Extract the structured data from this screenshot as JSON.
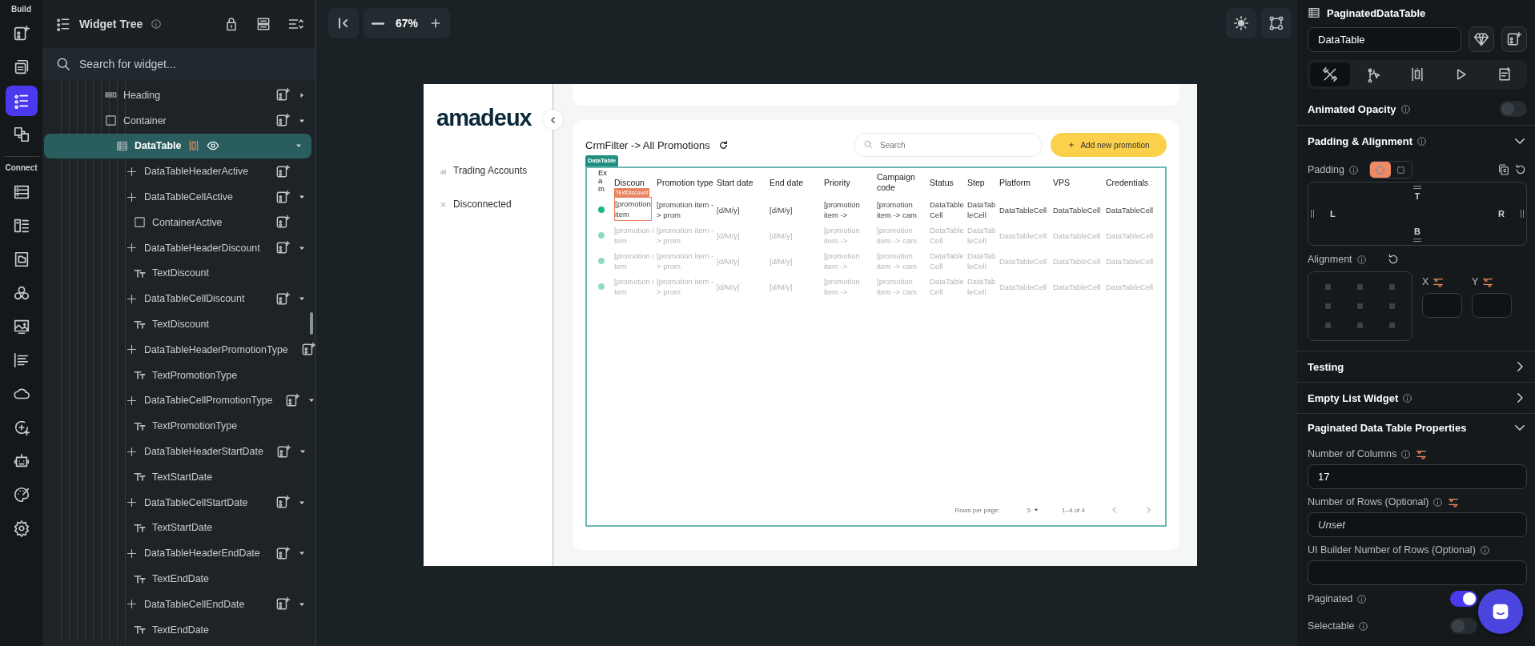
{
  "rail": {
    "build_label": "Build",
    "build": [
      {
        "selected": false
      },
      {
        "selected": false
      },
      {
        "selected": true
      },
      {
        "selected": false
      }
    ],
    "connect_label": "Connect",
    "connect": [
      {
        "selected": false
      },
      {
        "selected": false
      },
      {
        "selected": false
      },
      {
        "selected": false
      },
      {
        "selected": false
      },
      {
        "selected": false
      },
      {
        "selected": false
      },
      {
        "selected": false
      },
      {
        "selected": false
      },
      {
        "selected": false
      },
      {
        "selected": false
      }
    ]
  },
  "tree": {
    "title": "Widget Tree",
    "search": {
      "placeholder": "Search for widget..."
    },
    "items": [
      {
        "kind": "heading",
        "label": "Heading",
        "expanded": false,
        "selected": false
      },
      {
        "kind": "container",
        "label": "Container",
        "expanded": true,
        "selected": false,
        "children": [
          {
            "kind": "table",
            "label": "DataTable",
            "expanded": true,
            "selected": true,
            "children": [
              {
                "kind": "plus",
                "label": "DataTableHeaderActive",
                "selected": false
              },
              {
                "kind": "plus",
                "label": "DataTableCellActive",
                "expanded": true,
                "selected": false,
                "children": [
                  {
                    "kind": "container",
                    "label": "ContainerActive",
                    "selected": false
                  }
                ]
              },
              {
                "kind": "plus",
                "label": "DataTableHeaderDiscount",
                "expanded": true,
                "selected": false,
                "children": [
                  {
                    "kind": "text",
                    "label": "TextDiscount",
                    "selected": false
                  }
                ]
              },
              {
                "kind": "plus",
                "label": "DataTableCellDiscount",
                "expanded": true,
                "selected": false,
                "children": [
                  {
                    "kind": "text",
                    "label": "TextDiscount",
                    "selected": false
                  }
                ]
              },
              {
                "kind": "plus",
                "label": "DataTableHeaderPromotionType",
                "selected": false,
                "children": [
                  {
                    "kind": "text",
                    "label": "TextPromotionType",
                    "selected": false
                  }
                ]
              },
              {
                "kind": "plus",
                "label": "DataTableCellPromotionType",
                "expanded": true,
                "selected": false,
                "children": [
                  {
                    "kind": "text",
                    "label": "TextPromotionType",
                    "selected": false
                  }
                ]
              },
              {
                "kind": "plus",
                "label": "DataTableHeaderStartDate",
                "expanded": true,
                "selected": false,
                "children": [
                  {
                    "kind": "text",
                    "label": "TextStartDate",
                    "selected": false
                  }
                ]
              },
              {
                "kind": "plus",
                "label": "DataTableCellStartDate",
                "expanded": true,
                "selected": false,
                "children": [
                  {
                    "kind": "text",
                    "label": "TextStartDate",
                    "selected": false
                  }
                ]
              },
              {
                "kind": "plus",
                "label": "DataTableHeaderEndDate",
                "expanded": true,
                "selected": false,
                "children": [
                  {
                    "kind": "text",
                    "label": "TextEndDate",
                    "selected": false
                  }
                ]
              },
              {
                "kind": "plus",
                "label": "DataTableCellEndDate",
                "expanded": true,
                "selected": false,
                "children": [
                  {
                    "kind": "text",
                    "label": "TextEndDate",
                    "selected": false
                  }
                ]
              }
            ]
          }
        ]
      }
    ]
  },
  "canvas": {
    "zoom": "67%"
  },
  "app": {
    "logo": "amadeux",
    "nav": [
      {
        "kind": "chart",
        "label": "Trading Accounts"
      },
      {
        "kind": "cross",
        "label": "Disconnected"
      }
    ],
    "title": "CrmFilter -> All Promotions",
    "search": {
      "placeholder": "Search"
    },
    "add_button": "Add new promotion",
    "table": {
      "tag": "DataTable",
      "columns": [
        "Exam",
        "Discoun",
        "Promotion type",
        "Start date",
        "End date",
        "Priority",
        "Campaign code",
        "Status",
        "Step",
        "Platform",
        "VPS",
        "Credentials"
      ],
      "rows": [
        {
          "dimmed": false,
          "cells": [
            {
              "kind": "dot"
            },
            {
              "kind": "text",
              "text": "[promotion item",
              "selected": true,
              "tag": "TextDiscount"
            },
            {
              "kind": "text",
              "text": "[promotion item -> prom",
              "selected": false
            },
            {
              "kind": "text",
              "text": "[d/M/y]",
              "selected": false
            },
            {
              "kind": "text",
              "text": "[d/M/y]",
              "selected": false
            },
            {
              "kind": "text",
              "text": "[promotion item ->",
              "selected": false
            },
            {
              "kind": "text",
              "text": "[promotion item -> cam",
              "selected": false
            },
            {
              "kind": "text",
              "text": "DataTableCell",
              "selected": false
            },
            {
              "kind": "text",
              "text": "DataTableCell",
              "selected": false
            },
            {
              "kind": "text",
              "text": "DataTableCell",
              "selected": false
            },
            {
              "kind": "text",
              "text": "DataTableCell",
              "selected": false
            },
            {
              "kind": "text",
              "text": "DataTableCell",
              "selected": false
            }
          ]
        },
        {
          "dimmed": true,
          "cells": [
            {
              "kind": "dot"
            },
            {
              "kind": "text",
              "text": "[promotion item",
              "selected": false
            },
            {
              "kind": "text",
              "text": "[promotion item -> prom",
              "selected": false
            },
            {
              "kind": "text",
              "text": "[d/M/y]",
              "selected": false
            },
            {
              "kind": "text",
              "text": "[d/M/y]",
              "selected": false
            },
            {
              "kind": "text",
              "text": "[promotion item ->",
              "selected": false
            },
            {
              "kind": "text",
              "text": "[promotion item -> cam",
              "selected": false
            },
            {
              "kind": "text",
              "text": "DataTableCell",
              "selected": false
            },
            {
              "kind": "text",
              "text": "DataTableCell",
              "selected": false
            },
            {
              "kind": "text",
              "text": "DataTableCell",
              "selected": false
            },
            {
              "kind": "text",
              "text": "DataTableCell",
              "selected": false
            },
            {
              "kind": "text",
              "text": "DataTableCell",
              "selected": false
            }
          ]
        },
        {
          "dimmed": true,
          "cells": [
            {
              "kind": "dot"
            },
            {
              "kind": "text",
              "text": "[promotion item",
              "selected": false
            },
            {
              "kind": "text",
              "text": "[promotion item -> prom",
              "selected": false
            },
            {
              "kind": "text",
              "text": "[d/M/y]",
              "selected": false
            },
            {
              "kind": "text",
              "text": "[d/M/y]",
              "selected": false
            },
            {
              "kind": "text",
              "text": "[promotion item ->",
              "selected": false
            },
            {
              "kind": "text",
              "text": "[promotion item -> cam",
              "selected": false
            },
            {
              "kind": "text",
              "text": "DataTableCell",
              "selected": false
            },
            {
              "kind": "text",
              "text": "DataTableCell",
              "selected": false
            },
            {
              "kind": "text",
              "text": "DataTableCell",
              "selected": false
            },
            {
              "kind": "text",
              "text": "DataTableCell",
              "selected": false
            },
            {
              "kind": "text",
              "text": "DataTableCell",
              "selected": false
            }
          ]
        },
        {
          "dimmed": true,
          "cells": [
            {
              "kind": "dot"
            },
            {
              "kind": "text",
              "text": "[promotion item",
              "selected": false
            },
            {
              "kind": "text",
              "text": "[promotion item -> prom",
              "selected": false
            },
            {
              "kind": "text",
              "text": "[d/M/y]",
              "selected": false
            },
            {
              "kind": "text",
              "text": "[d/M/y]",
              "selected": false
            },
            {
              "kind": "text",
              "text": "[promotion item ->",
              "selected": false
            },
            {
              "kind": "text",
              "text": "[promotion item -> cam",
              "selected": false
            },
            {
              "kind": "text",
              "text": "DataTableCell",
              "selected": false
            },
            {
              "kind": "text",
              "text": "DataTableCell",
              "selected": false
            },
            {
              "kind": "text",
              "text": "DataTableCell",
              "selected": false
            },
            {
              "kind": "text",
              "text": "DataTableCell",
              "selected": false
            },
            {
              "kind": "text",
              "text": "DataTableCell",
              "selected": false
            }
          ]
        }
      ],
      "footer": {
        "rows_label": "Rows per page:",
        "rows_value": "5",
        "range": "1–4 of 4"
      }
    }
  },
  "properties": {
    "widget_type": "PaginatedDataTable",
    "name_field": {
      "value": "DataTable"
    },
    "tabs": [
      {
        "selected": true
      },
      {
        "selected": false
      },
      {
        "selected": false
      },
      {
        "selected": false
      },
      {
        "selected": false
      }
    ],
    "animated_opacity": {
      "label": "Animated Opacity",
      "on": false
    },
    "padding_section": {
      "title": "Padding & Alignment",
      "expanded": true,
      "padding_label": "Padding",
      "padding_modes": [
        {
          "selected": true
        },
        {
          "selected": false
        }
      ],
      "sides": {
        "top": "T",
        "left": "L",
        "right": "R",
        "bottom": "B"
      },
      "alignment_label": "Alignment",
      "x_label": "X",
      "y_label": "Y"
    },
    "sections": [
      {
        "title": "Testing",
        "expanded": false,
        "info": false
      },
      {
        "title": "Empty List Widget",
        "expanded": false,
        "info": true
      }
    ],
    "table_props": {
      "title": "Paginated Data Table Properties",
      "expanded": true,
      "fields": [
        {
          "label": "Number of Columns",
          "bindable": true,
          "value": "17"
        },
        {
          "label": "Number of Rows (Optional)",
          "bindable": true,
          "placeholder": "Unset"
        },
        {
          "label": "UI Builder Number of Rows (Optional)",
          "bindable": false
        }
      ],
      "toggles": [
        {
          "label": "Paginated",
          "on": true
        },
        {
          "label": "Selectable",
          "on": false
        }
      ]
    }
  }
}
